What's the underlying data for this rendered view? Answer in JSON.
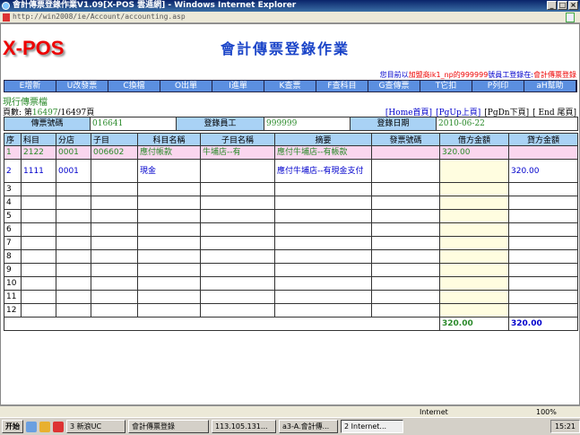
{
  "window": {
    "title": "會計傳票登錄作業V1.09[X-POS 雲遁網] - Windows Internet Explorer",
    "url": "http://win2008/ie/Account/accounting.asp"
  },
  "page": {
    "logo": "X-POS",
    "heading": "會計傳票登錄作業",
    "user_prefix": "您目前以",
    "user_franchise": "加盟商ik1_np的",
    "user_id": "999999",
    "user_mid": "號員工登錄在:",
    "user_module": "會計傳票登錄"
  },
  "toolbar": [
    "E增新",
    "U改發票",
    "C換檔",
    "O出單",
    "I進單",
    "K查票",
    "F查科目",
    "G查傳票",
    "T它扣",
    "P列印",
    "aH幫助"
  ],
  "current_file": "現行傳票檔",
  "pager": {
    "label": "頁數: 第",
    "current": "16497",
    "sep": "/",
    "total": "16497頁",
    "home": "[Home首頁]",
    "pgup": "[PgUp上頁]",
    "pgdn": "[PgDn下頁]",
    "end": "[ End 尾頁]"
  },
  "info": {
    "voucher_label": "傳票號碼",
    "voucher": "016641",
    "staff_label": "登錄員工",
    "staff": "999999",
    "date_label": "登錄日期",
    "date": "2010-06-22"
  },
  "columns": [
    "序",
    "科目",
    "分店",
    "子目",
    "科目名稱",
    "子目名稱",
    "摘要",
    "發票號碼",
    "借方金額",
    "貸方金額"
  ],
  "rows": [
    [
      "1",
      "2122",
      "0001",
      "006602",
      "應付帳款",
      "牛埔店--有",
      "應付牛埔店--有帳款",
      "",
      "320.00",
      ""
    ],
    [
      "2",
      "1111",
      "0001",
      "",
      "現金",
      "",
      "應付牛埔店--有現金支付",
      "",
      "",
      "320.00"
    ],
    [
      "3",
      "",
      "",
      "",
      "",
      "",
      "",
      "",
      "",
      ""
    ],
    [
      "4",
      "",
      "",
      "",
      "",
      "",
      "",
      "",
      "",
      ""
    ],
    [
      "5",
      "",
      "",
      "",
      "",
      "",
      "",
      "",
      "",
      ""
    ],
    [
      "6",
      "",
      "",
      "",
      "",
      "",
      "",
      "",
      "",
      ""
    ],
    [
      "7",
      "",
      "",
      "",
      "",
      "",
      "",
      "",
      "",
      ""
    ],
    [
      "8",
      "",
      "",
      "",
      "",
      "",
      "",
      "",
      "",
      ""
    ],
    [
      "9",
      "",
      "",
      "",
      "",
      "",
      "",
      "",
      "",
      ""
    ],
    [
      "10",
      "",
      "",
      "",
      "",
      "",
      "",
      "",
      "",
      ""
    ],
    [
      "11",
      "",
      "",
      "",
      "",
      "",
      "",
      "",
      "",
      ""
    ],
    [
      "12",
      "",
      "",
      "",
      "",
      "",
      "",
      "",
      "",
      ""
    ]
  ],
  "totals": {
    "debit": "320.00",
    "credit": "320.00"
  },
  "status": {
    "zone": "Internet",
    "zoom": "100%"
  },
  "taskbar": {
    "start": "开始",
    "items": [
      "3 新浪UC",
      "會計傳票登錄",
      "113.105.131...",
      "a3-A.會計傳...",
      "2 Internet..."
    ],
    "clock": "15:21"
  }
}
